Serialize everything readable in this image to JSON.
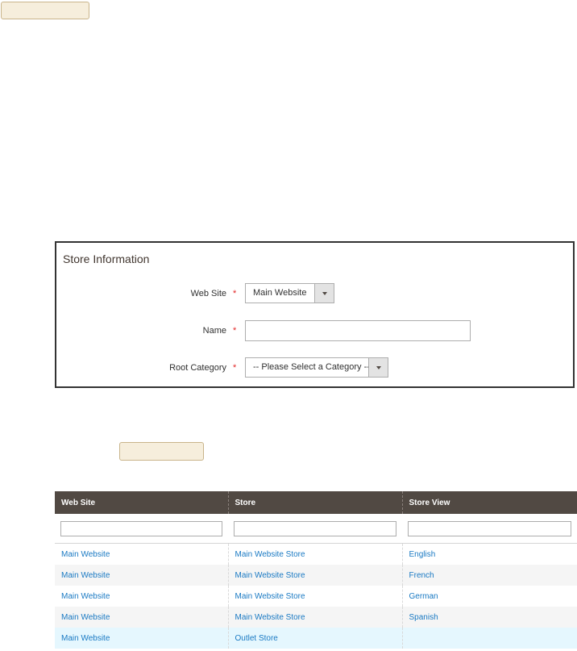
{
  "store_information": {
    "title": "Store Information",
    "fields": {
      "website": {
        "label": "Web Site",
        "required_mark": "*",
        "value": "Main Website"
      },
      "name": {
        "label": "Name",
        "required_mark": "*",
        "value": ""
      },
      "root_category": {
        "label": "Root Category",
        "required_mark": "*",
        "value": "-- Please Select a Category --"
      }
    }
  },
  "grid": {
    "columns": [
      "Web Site",
      "Store",
      "Store View"
    ],
    "filters": [
      "",
      "",
      ""
    ],
    "rows": [
      {
        "website": "Main Website",
        "store": "Main Website Store",
        "store_view": "English"
      },
      {
        "website": "Main Website",
        "store": "Main Website Store",
        "store_view": "French"
      },
      {
        "website": "Main Website",
        "store": "Main Website Store",
        "store_view": "German"
      },
      {
        "website": "Main Website",
        "store": "Main Website Store",
        "store_view": "Spanish"
      },
      {
        "website": "Main Website",
        "store": "Outlet Store",
        "store_view": ""
      }
    ]
  },
  "colors": {
    "grid_header": "#514943",
    "link": "#1979c3",
    "required": "#e22626",
    "selected_row": "#e5f7fe",
    "callout_fill": "#f6eedc"
  }
}
